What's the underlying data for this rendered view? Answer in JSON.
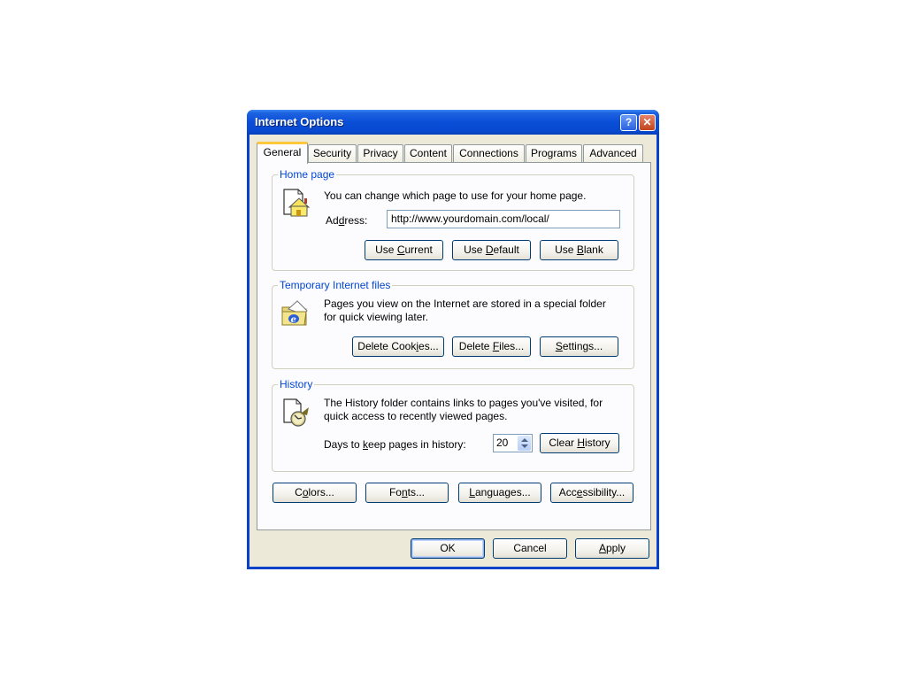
{
  "window": {
    "title": "Internet Options",
    "help_button": "?",
    "close_button": "✕"
  },
  "tabs": [
    {
      "label": "General",
      "active": true
    },
    {
      "label": "Security",
      "active": false
    },
    {
      "label": "Privacy",
      "active": false
    },
    {
      "label": "Content",
      "active": false
    },
    {
      "label": "Connections",
      "active": false
    },
    {
      "label": "Programs",
      "active": false
    },
    {
      "label": "Advanced",
      "active": false
    }
  ],
  "home_page": {
    "legend": "Home page",
    "description": "You can change which page to use for your home page.",
    "address_label_pre": "Ad",
    "address_label_u": "d",
    "address_label_post": "ress:",
    "address_value": "http://www.yourdomain.com/local/",
    "buttons": {
      "use_current": {
        "pre": "Use ",
        "u": "C",
        "post": "urrent"
      },
      "use_default": {
        "pre": "Use ",
        "u": "D",
        "post": "efault"
      },
      "use_blank": {
        "pre": "Use ",
        "u": "B",
        "post": "lank"
      }
    }
  },
  "temp_files": {
    "legend": "Temporary Internet files",
    "description_line1": "Pages you view on the Internet are stored in a special folder",
    "description_line2": "for quick viewing later.",
    "buttons": {
      "delete_cookies": {
        "pre": "Delete Cook",
        "u": "i",
        "post": "es..."
      },
      "delete_files": {
        "pre": "Delete ",
        "u": "F",
        "post": "iles..."
      },
      "settings": {
        "pre": "",
        "u": "S",
        "post": "ettings..."
      }
    }
  },
  "history": {
    "legend": "History",
    "description_line1": "The History folder contains links to pages you've visited, for",
    "description_line2": "quick access to recently viewed pages.",
    "days_label_pre": "Days to ",
    "days_label_u": "k",
    "days_label_post": "eep pages in history:",
    "days_value": "20",
    "clear_button": {
      "pre": "Clear ",
      "u": "H",
      "post": "istory"
    }
  },
  "bottom_buttons": {
    "colors": {
      "pre": "C",
      "u": "o",
      "post": "lors..."
    },
    "fonts": {
      "pre": "Fo",
      "u": "n",
      "post": "ts..."
    },
    "languages": {
      "pre": "",
      "u": "L",
      "post": "anguages..."
    },
    "accessibility": {
      "pre": "Acc",
      "u": "e",
      "post": "ssibility..."
    }
  },
  "dialog_buttons": {
    "ok": "OK",
    "cancel": "Cancel",
    "apply": {
      "pre": "",
      "u": "A",
      "post": "pply"
    }
  }
}
